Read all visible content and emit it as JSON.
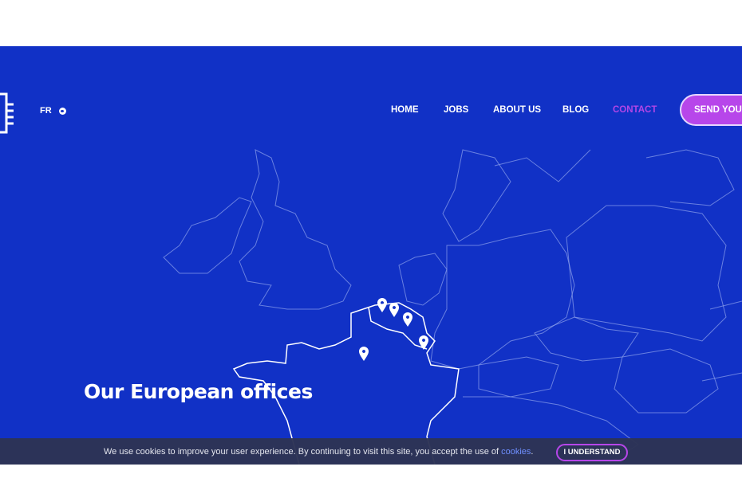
{
  "header": {
    "language": "FR",
    "language_icon": "globe-icon",
    "nav": [
      {
        "label": "HOME",
        "active": false
      },
      {
        "label": "JOBS",
        "active": false
      },
      {
        "label": "ABOUT US",
        "active": false
      },
      {
        "label": "BLOG",
        "active": false
      },
      {
        "label": "CONTACT",
        "active": true
      }
    ],
    "cta_label": "SEND YOUR"
  },
  "hero": {
    "title": "Our European offices",
    "pin_count": 5
  },
  "cookie_banner": {
    "text": "We use cookies to improve your user experience. By continuing to visit this site, you accept the use of ",
    "link": "cookies",
    "suffix": ".",
    "button": "I UNDERSTAND"
  },
  "colors": {
    "background": "#1131c6",
    "accent": "#b746ea",
    "cookie_bar": "#2d3455"
  }
}
